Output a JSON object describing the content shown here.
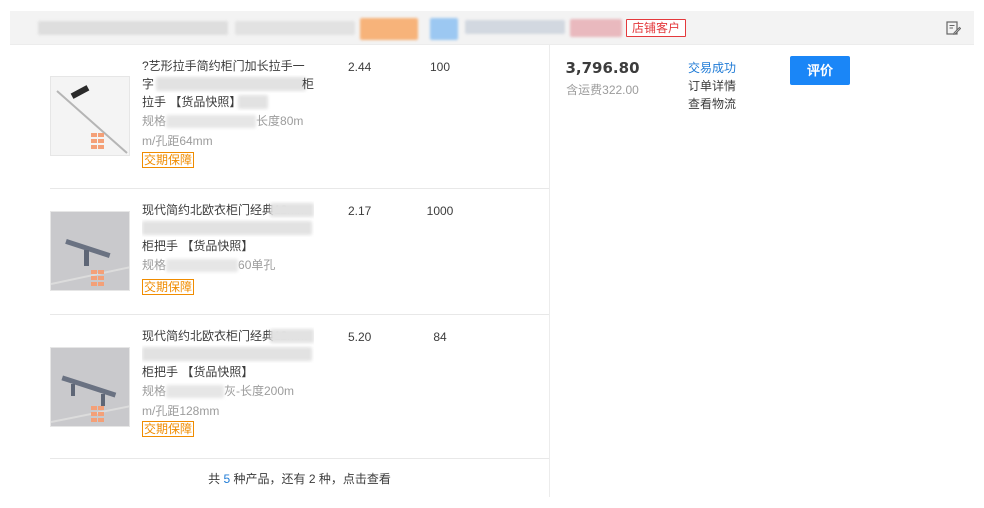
{
  "header": {
    "customer_badge": "店铺客户"
  },
  "items": [
    {
      "title_lines": [
        "?艺形拉手简约柜门加长拉手一",
        "字",
        "拉手"
      ],
      "snapshot": "【货品快照】",
      "spec_prefix": "规格",
      "spec_suffix": "长度80m",
      "spec_line2": "m/孔距64mm",
      "guarantee": "交期保障",
      "price": "2.44",
      "qty": "100"
    },
    {
      "title_lines": [
        "现代简约北欧衣柜门经典12mm",
        "",
        "柜把手"
      ],
      "snapshot": "【货品快照】",
      "spec_prefix": "规格",
      "spec_suffix": "60单孔",
      "spec_line2": "",
      "guarantee": "交期保障",
      "price": "2.17",
      "qty": "1000"
    },
    {
      "title_lines": [
        "现代简约北欧衣柜门经典12mm",
        "",
        "柜把手"
      ],
      "snapshot": "【货品快照】",
      "spec_prefix": "规格",
      "spec_suffix": "灰-长度200m",
      "spec_line2": "m/孔距128mm",
      "guarantee": "交期保障",
      "price": "5.20",
      "qty": "84"
    }
  ],
  "more": {
    "prefix": "共",
    "count": "5",
    "middle": "种产品，还有",
    "remaining": "2",
    "suffix": "种，点击查看"
  },
  "order": {
    "total": "3,796.80",
    "shipping": "含运费322.00",
    "status": "交易成功",
    "detail_link": "订单详情",
    "logistics_link": "查看物流",
    "rate_button": "评价"
  },
  "colors": {
    "accent_blue": "#1a86f7",
    "link_blue": "#1f7bd6",
    "badge_red": "#e4393c",
    "guarantee_orange": "#f08c00"
  },
  "icons": {
    "header_action": "note-edit-icon"
  }
}
